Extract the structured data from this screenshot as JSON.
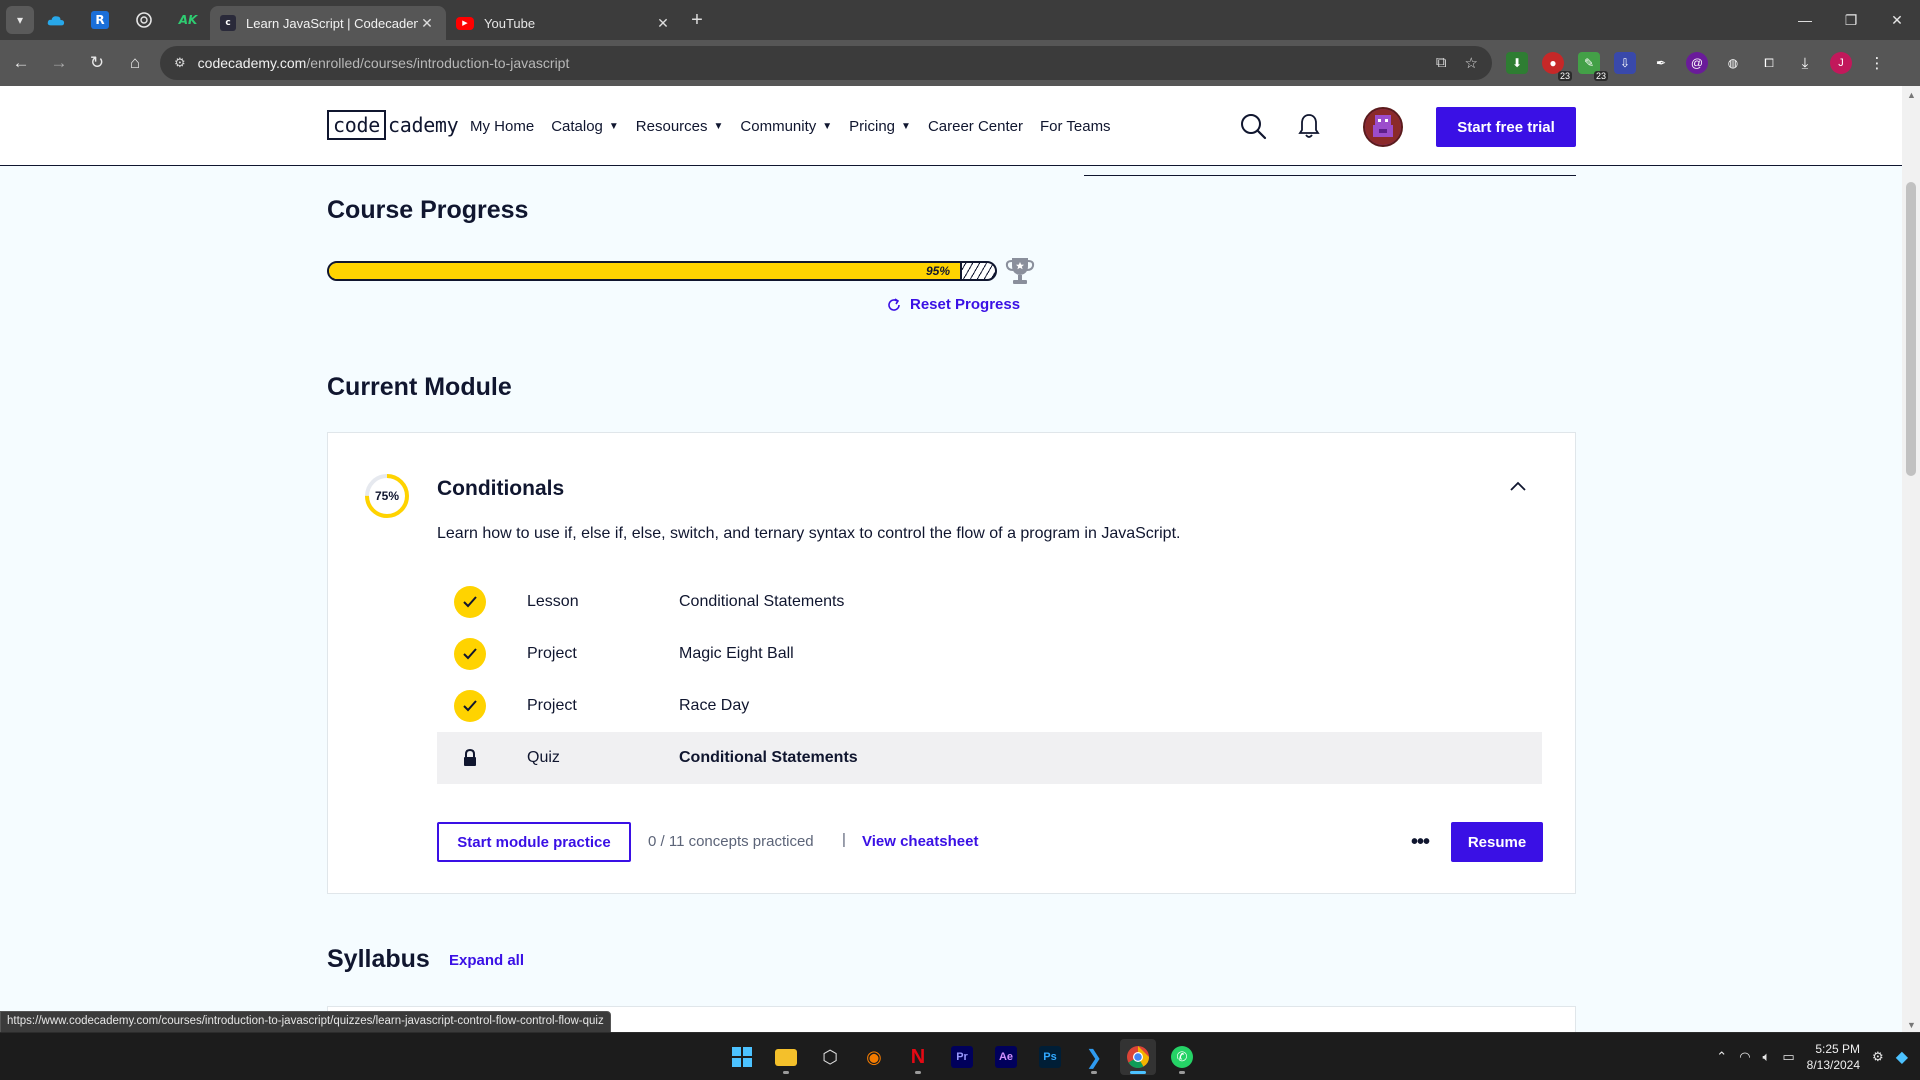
{
  "browser": {
    "tabs": [
      {
        "title": "Learn JavaScript | Codecademy",
        "active": true
      },
      {
        "title": "YouTube",
        "active": false
      }
    ],
    "pinned_icons": [
      "onedrive-icon",
      "r-icon",
      "chatgpt-icon",
      "ak-icon"
    ],
    "url_host": "codecademy.com",
    "url_path": "/enrolled/courses/introduction-to-javascript",
    "extension_badges": [
      "23",
      "23"
    ],
    "profile_initial": "J",
    "status_url": "https://www.codecademy.com/courses/introduction-to-javascript/quizzes/learn-javascript-control-flow-control-flow-quiz"
  },
  "header": {
    "logo_code": "code",
    "logo_cademy": "cademy",
    "nav": [
      {
        "label": "My Home",
        "dropdown": false
      },
      {
        "label": "Catalog",
        "dropdown": true
      },
      {
        "label": "Resources",
        "dropdown": true
      },
      {
        "label": "Community",
        "dropdown": true
      },
      {
        "label": "Pricing",
        "dropdown": true
      },
      {
        "label": "Career Center",
        "dropdown": false
      },
      {
        "label": "For Teams",
        "dropdown": false
      }
    ],
    "cta": "Start free trial"
  },
  "progress": {
    "heading": "Course Progress",
    "percent": 95,
    "percent_label": "95%",
    "reset_label": "Reset Progress"
  },
  "module": {
    "heading": "Current Module",
    "percent": 75,
    "percent_label": "75%",
    "title": "Conditionals",
    "description": "Learn how to use if, else if, else, switch, and ternary syntax to control the flow of a program in JavaScript.",
    "items": [
      {
        "type": "Lesson",
        "name": "Conditional Statements",
        "status": "complete"
      },
      {
        "type": "Project",
        "name": "Magic Eight Ball",
        "status": "complete"
      },
      {
        "type": "Project",
        "name": "Race Day",
        "status": "complete"
      },
      {
        "type": "Quiz",
        "name": "Conditional Statements",
        "status": "locked"
      }
    ],
    "practice_label": "Start module practice",
    "concepts": "0 / 11 concepts practiced",
    "separator": "|",
    "cheatsheet_label": "View cheatsheet",
    "more_label": "•••",
    "resume_label": "Resume"
  },
  "syllabus": {
    "heading": "Syllabus",
    "expand_label": "Expand all"
  },
  "taskbar": {
    "apps": [
      "windows-start-icon",
      "file-explorer-icon",
      "unity-icon",
      "blender-icon",
      "netflix-icon",
      "premiere-pro-icon",
      "after-effects-icon",
      "photoshop-icon",
      "vscode-icon",
      "chrome-icon",
      "whatsapp-icon"
    ],
    "time": "5:25 PM",
    "date": "8/13/2024"
  },
  "colors": {
    "accent": "#3a10e5",
    "progress_yellow": "#ffd300",
    "navy": "#10162f",
    "page_bg": "#f5fcff"
  }
}
